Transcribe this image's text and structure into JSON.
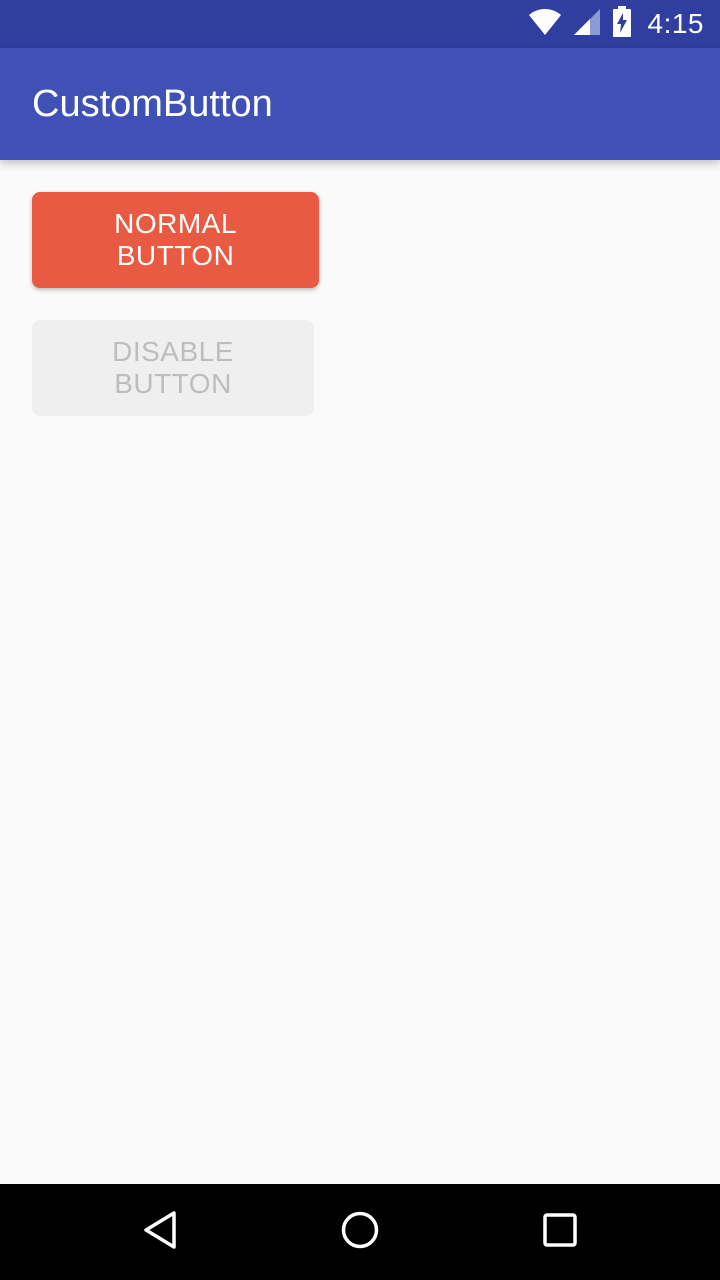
{
  "status_bar": {
    "time": "4:15",
    "icons": [
      "wifi-icon",
      "signal-icon",
      "battery-charging-icon"
    ],
    "background": "#303F9F"
  },
  "app_bar": {
    "title": "CustomButton",
    "background": "#3F51B5"
  },
  "buttons": {
    "normal": {
      "label": "NORMAL BUTTON",
      "color": "#E95A42",
      "enabled": true
    },
    "disabled": {
      "label": "DISABLE BUTTON",
      "color": "#EFEFEF",
      "enabled": false
    }
  },
  "nav_bar": {
    "icons": [
      "back-icon",
      "home-icon",
      "recents-icon"
    ]
  }
}
